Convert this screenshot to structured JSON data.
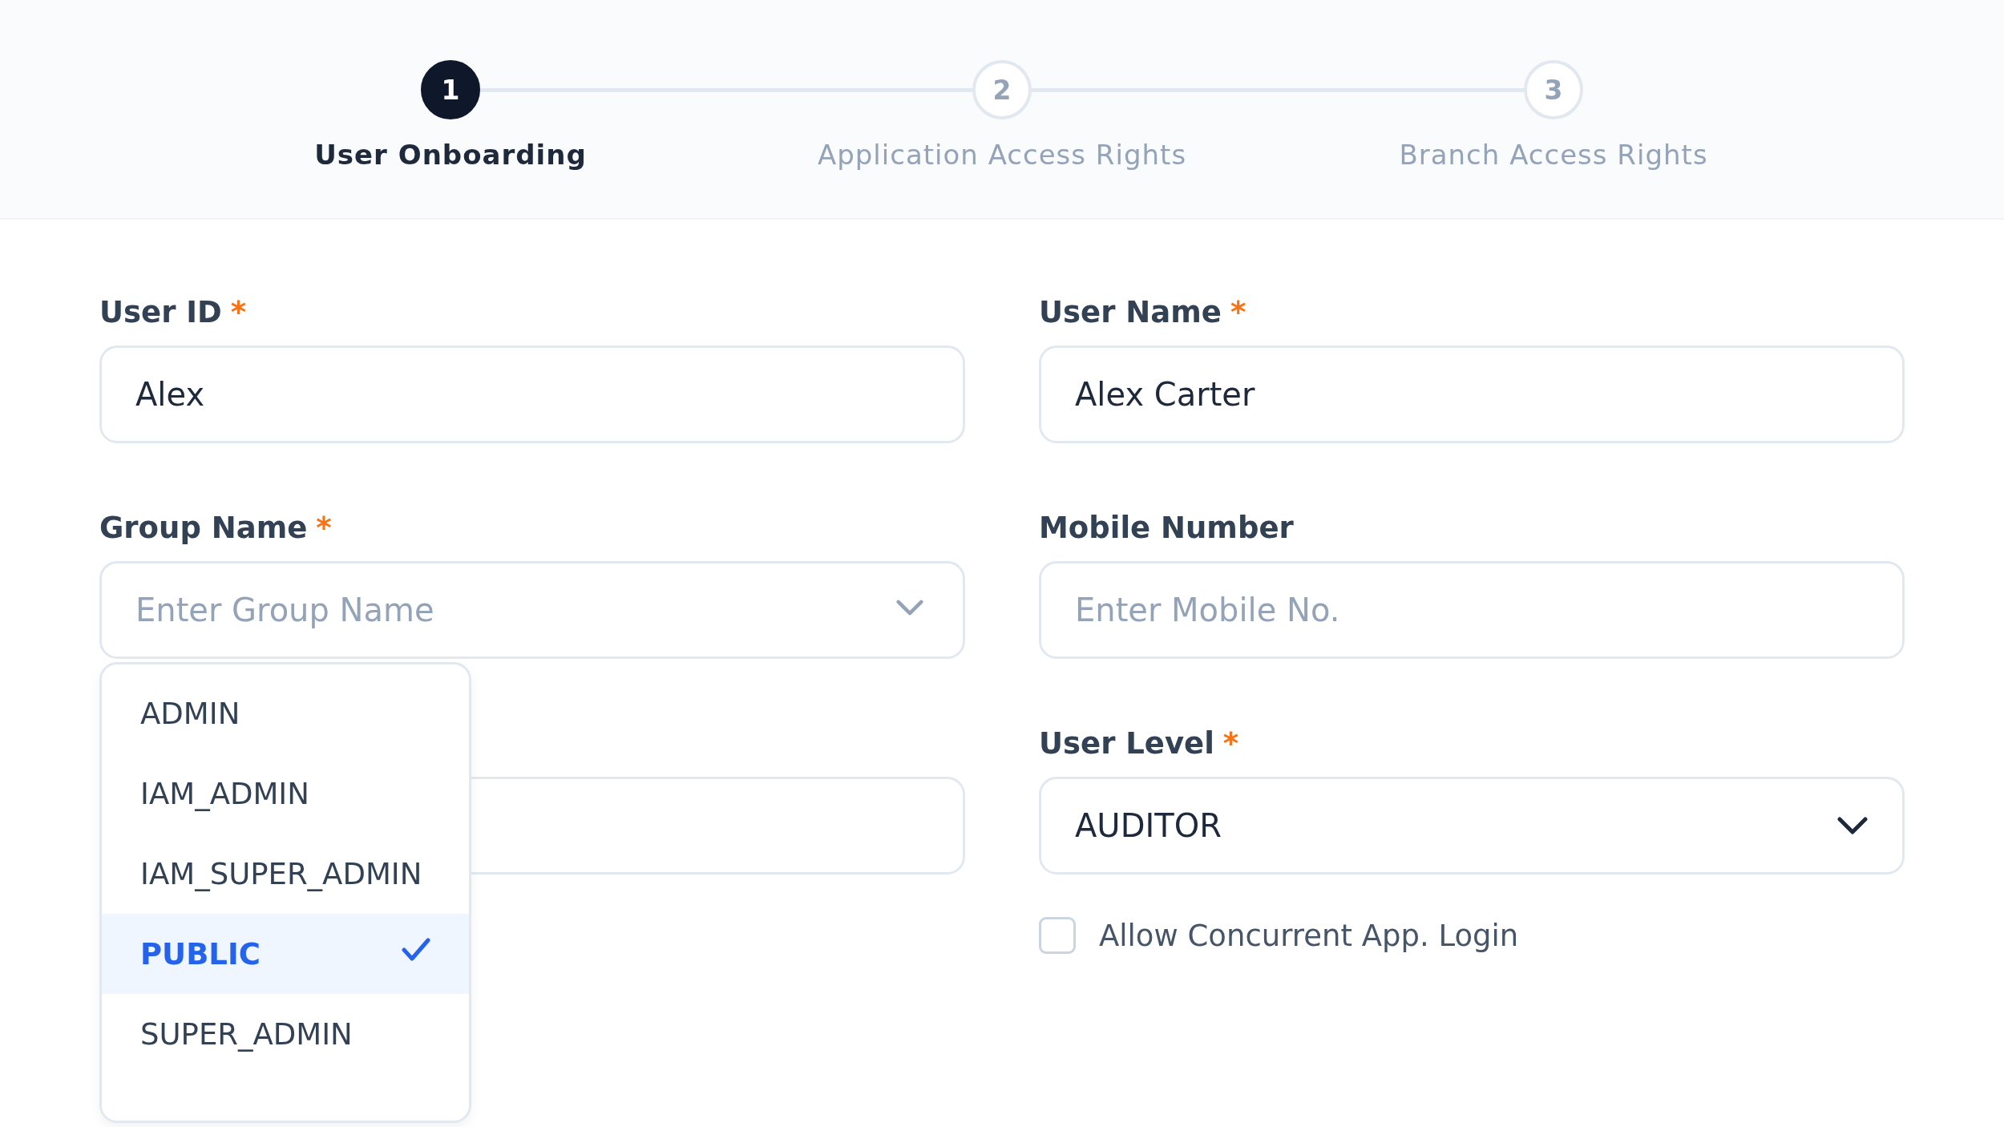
{
  "stepper": {
    "steps": [
      {
        "number": "1",
        "label": "User Onboarding",
        "selected": true
      },
      {
        "number": "2",
        "label": "Application Access Rights",
        "selected": false
      },
      {
        "number": "3",
        "label": "Branch Access Rights",
        "selected": false
      }
    ]
  },
  "form": {
    "left_column": [
      {
        "kind": "text",
        "label": "User ID",
        "required_mark": "*",
        "value": "Alex"
      },
      {
        "kind": "select",
        "label": "Group Name",
        "required_mark": "*",
        "placeholder": "Enter Group Name",
        "options": [
          {
            "label": "ADMIN",
            "selected": false
          },
          {
            "label": "IAM_ADMIN",
            "selected": false
          },
          {
            "label": "IAM_SUPER_ADMIN",
            "selected": false
          },
          {
            "label": "PUBLIC",
            "selected": true
          },
          {
            "label": "SUPER_ADMIN",
            "selected": false
          }
        ]
      },
      {
        "kind": "text"
      }
    ],
    "right_column": [
      {
        "kind": "text",
        "label": "User Name",
        "required_mark": "*",
        "value": "Alex Carter"
      },
      {
        "kind": "text",
        "label": "Mobile Number",
        "placeholder": "Enter Mobile No."
      },
      {
        "kind": "select",
        "label": "User Level",
        "required_mark": "*",
        "value": "AUDITOR"
      },
      {
        "kind": "checkbox",
        "label": "Allow Concurrent App. Login",
        "checked": false
      }
    ]
  }
}
